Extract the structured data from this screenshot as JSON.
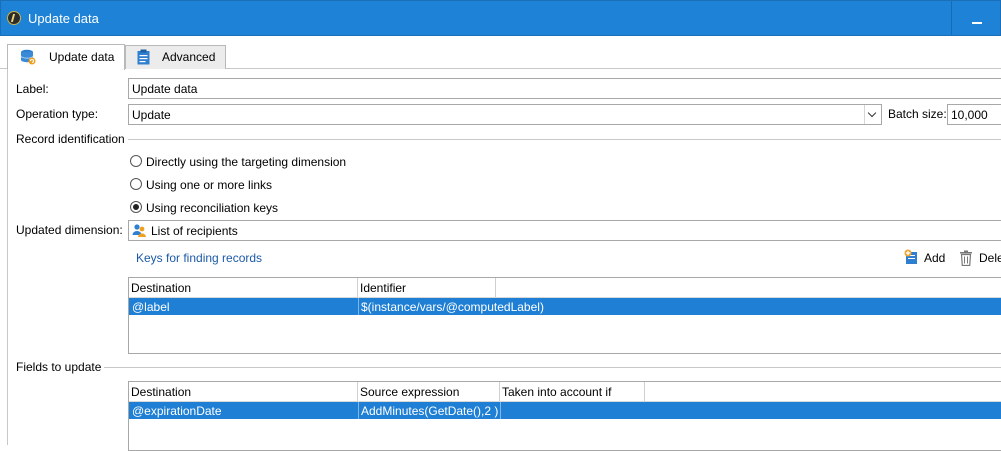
{
  "window": {
    "title": "Update data"
  },
  "tabs": [
    {
      "label": "Update data",
      "icon": "database-update-icon"
    },
    {
      "label": "Advanced",
      "icon": "clipboard-icon"
    }
  ],
  "form": {
    "label_caption": "Label:",
    "label_value": "Update data",
    "operation_caption": "Operation type:",
    "operation_value": "Update",
    "batch_caption": "Batch size:",
    "batch_value": "10,000"
  },
  "record_identification": {
    "title": "Record identification",
    "options": [
      {
        "label": "Directly using the targeting dimension",
        "selected": false
      },
      {
        "label": "Using one or more links",
        "selected": false
      },
      {
        "label": "Using reconciliation keys",
        "selected": true
      }
    ]
  },
  "updated_dimension": {
    "caption": "Updated dimension:",
    "value": "List of recipients"
  },
  "keys": {
    "title": "Keys for finding records",
    "add_label": "Add",
    "delete_label": "Dele",
    "columns": [
      "Destination",
      "Identifier"
    ],
    "rows": [
      [
        "@label",
        "$(instance/vars/@computedLabel)"
      ]
    ]
  },
  "fields_to_update": {
    "title": "Fields to update",
    "columns": [
      "Destination",
      "Source expression",
      "Taken into account if"
    ],
    "rows": [
      [
        "@expirationDate",
        "AddMinutes(GetDate(),2 )",
        ""
      ]
    ]
  },
  "colors": {
    "titlebar": "#1e82d6",
    "selection": "#1e7fd4",
    "link": "#1c5aa6"
  }
}
